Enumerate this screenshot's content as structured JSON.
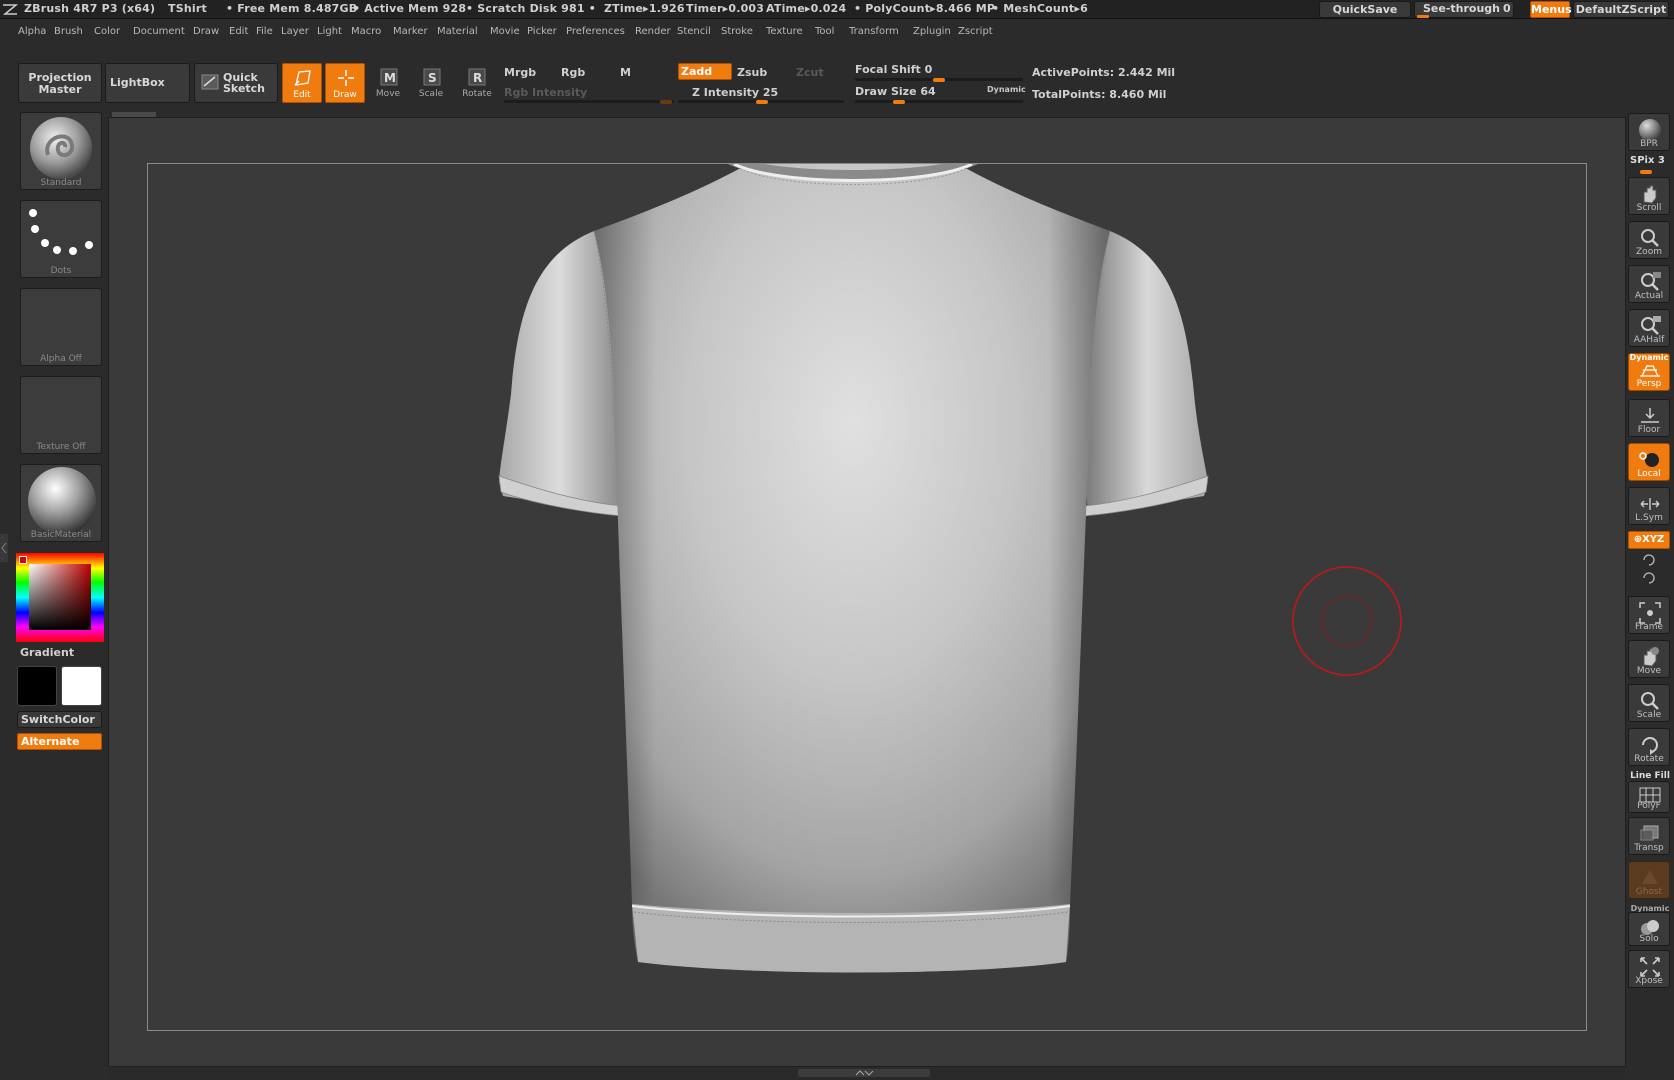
{
  "title_bar": {
    "app": "ZBrush 4R7 P3 (x64)",
    "document": "TShirt",
    "free_mem": "• Free Mem 8.487GB",
    "active_mem": "• Active Mem 928",
    "scratch_disk": "• Scratch Disk 981 •",
    "ztime": "ZTime▸1.926",
    "timer": "Timer▸0.003",
    "atime": "ATime▸0.024",
    "polycount": "• PolyCount▸8.466 MP",
    "meshcount": "• MeshCount▸6",
    "quicksave": "QuickSave",
    "see_through": "See-through",
    "see_through_value": "0",
    "menus": "Menus",
    "default_zscript": "DefaultZScript"
  },
  "menu": [
    "Alpha",
    "Brush",
    "Color",
    "Document",
    "Draw",
    "Edit",
    "File",
    "Layer",
    "Light",
    "Macro",
    "Marker",
    "Material",
    "Movie",
    "Picker",
    "Preferences",
    "Render",
    "Stencil",
    "Stroke",
    "Texture",
    "Tool",
    "Transform",
    "Zplugin",
    "Zscript"
  ],
  "top_shelf": {
    "projection_master_1": "Projection",
    "projection_master_2": "Master",
    "lightbox": "LightBox",
    "quick_sketch_1": "Quick",
    "quick_sketch_2": "Sketch",
    "edit": "Edit",
    "draw": "Draw",
    "move": "Move",
    "scale": "Scale",
    "rotate": "Rotate",
    "mrgb": "Mrgb",
    "rgb": "Rgb",
    "m": "M",
    "zadd": "Zadd",
    "zsub": "Zsub",
    "zcut": "Zcut",
    "rgb_intensity": "Rgb Intensity",
    "z_intensity": "Z Intensity 25",
    "focal_shift": "Focal Shift 0",
    "draw_size": "Draw Size 64",
    "dynamic": "Dynamic",
    "active_points": "ActivePoints: 2.442 Mil",
    "total_points": "TotalPoints: 8.460 Mil",
    "z_intensity_level": 25,
    "focal_shift_level": 0,
    "draw_size_level": 64
  },
  "left_shelf": {
    "brush": "Standard",
    "stroke": "Dots",
    "alpha": "Alpha  Off",
    "texture": "Texture  Off",
    "material": "BasicMaterial",
    "gradient": "Gradient",
    "switch_color": "SwitchColor",
    "alternate": "Alternate"
  },
  "right_shelf": {
    "bpr": "BPR",
    "spix": "SPix 3",
    "scroll": "Scroll",
    "zoom": "Zoom",
    "actual": "Actual",
    "aahalf": "AAHalf",
    "dynamic": "Dynamic",
    "persp": "Persp",
    "floor": "Floor",
    "local": "Local",
    "lsym": "L.Sym",
    "xyz": "⊕XYZ",
    "frame": "Frame",
    "move": "Move",
    "scale": "Scale",
    "rotate": "Rotate",
    "line_fill": "Line Fill",
    "polyf": "PolyF",
    "transp": "Transp",
    "ghost": "Ghost",
    "dynamic2": "Dynamic",
    "solo": "Solo",
    "xpose": "Xpose"
  },
  "colors": {
    "accent": "#f07c10",
    "panel": "#2b2b2b",
    "canvas": "#3a3a3a",
    "brush_cursor": "#c01818"
  }
}
